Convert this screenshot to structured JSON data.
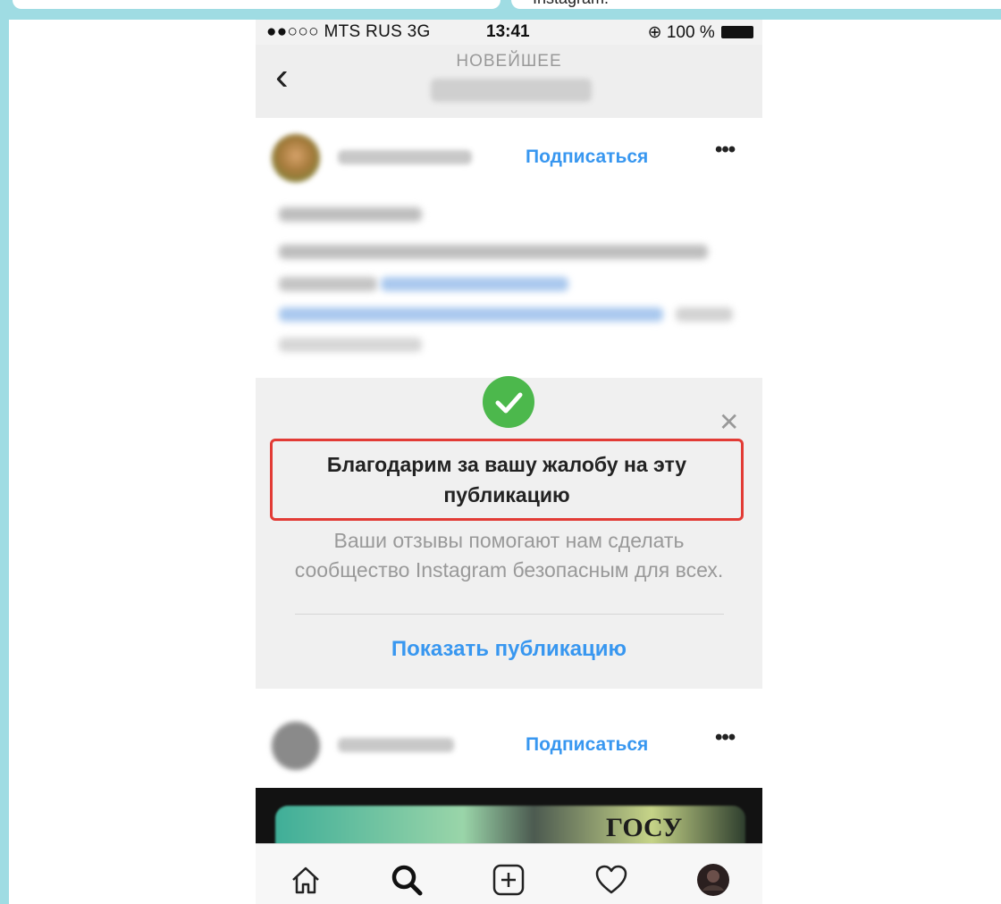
{
  "background_snippet": "Instagram.",
  "status_bar": {
    "carrier": "●●○○○ MTS RUS   3G",
    "time": "13:41",
    "battery": "100 %"
  },
  "nav": {
    "subtitle": "НОВЕЙШЕЕ"
  },
  "posts": [
    {
      "follow_label": "Подписаться",
      "more_label": "•••"
    },
    {
      "follow_label": "Подписаться",
      "more_label": "•••"
    }
  ],
  "report_notice": {
    "title": "Благодарим за вашу жалобу на эту публикацию",
    "description": "Ваши отзывы помогают нам сделать сообщество Instagram безопасным для всех.",
    "show_post_label": "Показать публикацию",
    "close_label": "✕"
  },
  "photo_text": "ГОСУ",
  "tabbar": [
    {
      "icon": "home-icon"
    },
    {
      "icon": "search-icon"
    },
    {
      "icon": "add-post-icon"
    },
    {
      "icon": "heart-icon"
    },
    {
      "icon": "profile-avatar"
    }
  ],
  "colors": {
    "accent_blue": "#3897f0",
    "highlight_red": "#e23b35",
    "success_green": "#4cb84c",
    "frame_teal": "#9fdce3"
  }
}
